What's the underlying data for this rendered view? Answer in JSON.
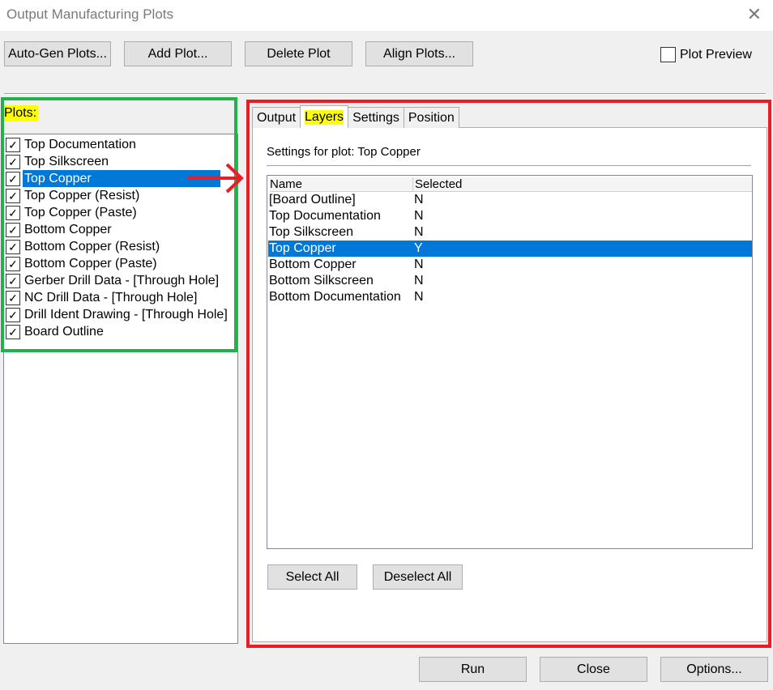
{
  "window": {
    "title": "Output Manufacturing Plots"
  },
  "toolbar": {
    "auto_gen": "Auto-Gen Plots...",
    "add_plot": "Add Plot...",
    "delete_plot": "Delete Plot",
    "align_plots": "Align Plots...",
    "plot_preview": "Plot Preview",
    "plot_preview_checked": false
  },
  "plots": {
    "label": "Plots:",
    "items": [
      {
        "label": "Top Documentation",
        "checked": true
      },
      {
        "label": "Top Silkscreen",
        "checked": true
      },
      {
        "label": "Top Copper",
        "checked": true,
        "selected": true
      },
      {
        "label": "Top Copper (Resist)",
        "checked": true
      },
      {
        "label": "Top Copper (Paste)",
        "checked": true
      },
      {
        "label": "Bottom Copper",
        "checked": true
      },
      {
        "label": "Bottom Copper (Resist)",
        "checked": true
      },
      {
        "label": "Bottom Copper (Paste)",
        "checked": true
      },
      {
        "label": "Gerber Drill Data - [Through Hole]",
        "checked": true
      },
      {
        "label": "NC Drill Data - [Through Hole]",
        "checked": true
      },
      {
        "label": "Drill Ident Drawing - [Through Hole]",
        "checked": true
      },
      {
        "label": "Board Outline",
        "checked": true
      }
    ]
  },
  "tabs": [
    {
      "label": "Output"
    },
    {
      "label": "Layers",
      "active": true
    },
    {
      "label": "Settings"
    },
    {
      "label": "Position"
    }
  ],
  "layers": {
    "settings_for": "Settings for plot: Top Copper",
    "columns": [
      "Name",
      "Selected"
    ],
    "rows": [
      {
        "name": "[Board Outline]",
        "selected": "N"
      },
      {
        "name": "Top Documentation",
        "selected": "N"
      },
      {
        "name": "Top Silkscreen",
        "selected": "N"
      },
      {
        "name": "Top Copper",
        "selected": "Y",
        "highlight": true
      },
      {
        "name": "Bottom Copper",
        "selected": "N"
      },
      {
        "name": "Bottom Silkscreen",
        "selected": "N"
      },
      {
        "name": "Bottom Documentation",
        "selected": "N"
      }
    ],
    "select_all": "Select All",
    "deselect_all": "Deselect All"
  },
  "footer": {
    "run": "Run",
    "close": "Close",
    "options": "Options..."
  },
  "colors": {
    "selection": "#0078d7",
    "highlight": "#ffff00",
    "green_box": "#22b14c",
    "red_box": "#ed1c24"
  },
  "icons": {
    "close": "close-icon",
    "check": "check-icon",
    "arrow": "arrow-right-icon"
  }
}
